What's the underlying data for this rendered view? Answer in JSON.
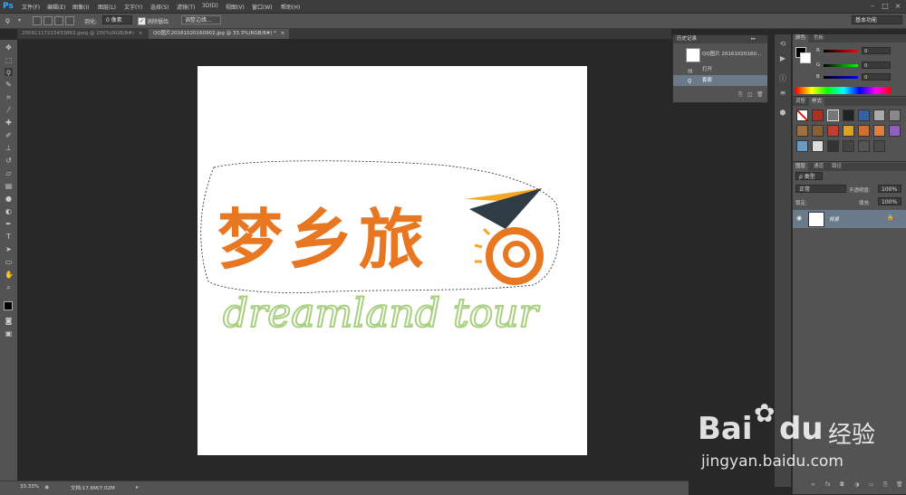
{
  "app": {
    "logo": "Ps"
  },
  "menu": [
    "文件(F)",
    "编辑(E)",
    "图像(I)",
    "图层(L)",
    "文字(Y)",
    "选择(S)",
    "滤镜(T)",
    "3D(D)",
    "视图(V)",
    "窗口(W)",
    "帮助(H)"
  ],
  "options": {
    "feather_label": "羽化:",
    "feather_value": "0 像素",
    "antialias_label": "消除锯齿",
    "refine_button": "调整边缘...",
    "workspace": "基本功能"
  },
  "tabs": [
    {
      "label": "20091117223433863.jpeg @ 100%(RGB/8#)",
      "close": "×",
      "active": false
    },
    {
      "label": "QQ图片20161020160902.jpg @ 33.3%(RGB/8#) *",
      "close": "×",
      "active": true
    }
  ],
  "history": {
    "title": "历史记录",
    "snapshot": "QQ图片 20161020160...",
    "items": [
      "打开",
      "套索"
    ]
  },
  "color_panel": {
    "tabs": [
      "颜色",
      "色板"
    ],
    "channels": [
      {
        "label": "R",
        "value": "0",
        "color": "#e03030"
      },
      {
        "label": "G",
        "value": "0",
        "color": "#30c030"
      },
      {
        "label": "B",
        "value": "0",
        "color": "#3050e0"
      }
    ]
  },
  "styles_panel": {
    "tabs": [
      "调整",
      "样式"
    ]
  },
  "layers_panel": {
    "tabs": [
      "图层",
      "通道",
      "路径"
    ],
    "kind_label": "ρ 类型",
    "blend_mode": "正常",
    "opacity_label": "不透明度:",
    "opacity_value": "100%",
    "lock_label": "锁定:",
    "fill_label": "填充:",
    "fill_value": "100%",
    "layer_name": "背景"
  },
  "status": {
    "zoom": "33.33%",
    "doc_info": "文档:17.6M/7.02M"
  },
  "artwork": {
    "title_cn": "梦乡旅",
    "subtitle": "dreamland tour",
    "orange": "#e87722",
    "green": "#a8d080",
    "dark": "#2f3b45",
    "yellow": "#f5a623"
  },
  "watermark": {
    "brand": "Bai",
    "brand2": "du",
    "cn": "经验",
    "url": "jingyan.baidu.com"
  }
}
